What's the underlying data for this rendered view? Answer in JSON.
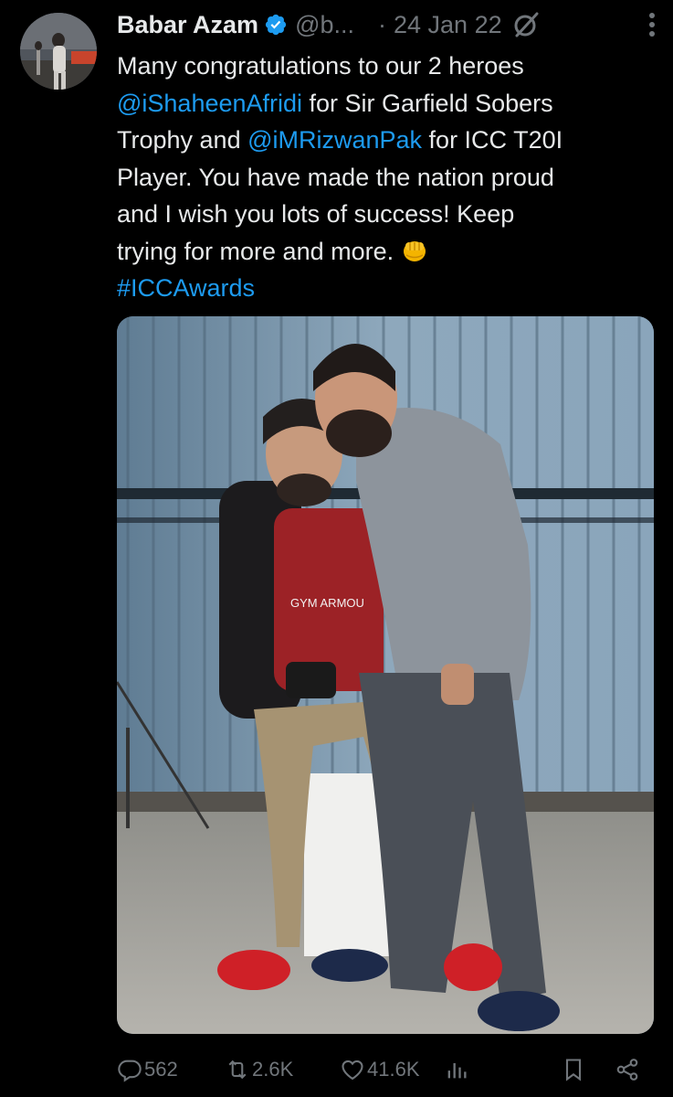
{
  "tweet": {
    "author_name": "Babar Azam",
    "handle": "@b...",
    "separator": "·",
    "date": "24 Jan 22",
    "text": {
      "line1": "Many congratulations to our 2 heroes",
      "mention1": "@iShaheenAfridi",
      "line2_after": " for Sir Garfield Sobers",
      "line3_before": "Trophy and ",
      "mention2": "@iMRizwanPak",
      "line3_after": " for ICC T20I",
      "line4": "Player. You have made the nation proud",
      "line5": "and I wish you lots of success! Keep",
      "line6": "trying for more and more. ",
      "hashtag": "#ICCAwards"
    },
    "image_shirt_text": "GYM ARMOU"
  },
  "actions": {
    "replies": "562",
    "reposts": "2.6K",
    "likes": "41.6K"
  },
  "icons": [
    "verified-badge-icon",
    "grok-icon",
    "more-icon",
    "reply-icon",
    "repost-icon",
    "like-icon",
    "analytics-icon",
    "bookmark-icon",
    "share-icon",
    "oncoming-fist-emoji"
  ],
  "colors": {
    "background": "#000000",
    "text": "#e7e9ea",
    "muted": "#71767b",
    "accent": "#1d9bf0"
  }
}
